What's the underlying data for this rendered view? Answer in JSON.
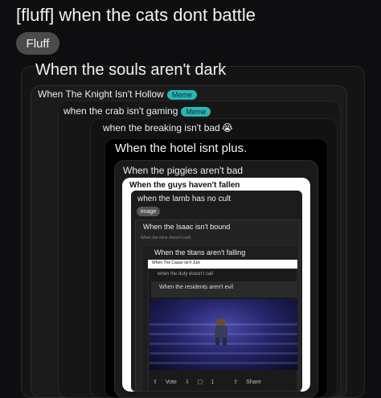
{
  "post": {
    "title": "[fluff] when the cats dont battle",
    "flair": "Fluff"
  },
  "nested": [
    {
      "text": "When the souls aren't dark"
    },
    {
      "text": "When The Knight Isn't Hollow",
      "badge": "Meme"
    },
    {
      "text": "when the crab isn't gaming",
      "badge": "Meme"
    },
    {
      "text": "when the breaking isn't bad",
      "emoji": "😭"
    },
    {
      "text": "When the hotel isnt plus."
    },
    {
      "text": "When the piggies aren't bad"
    },
    {
      "text": "When the guys haven't fallen"
    },
    {
      "text": "when the lamb has no cult",
      "badge": "Image"
    },
    {
      "text": "When the Isaac isn't bound"
    },
    {
      "text": "When the mine doesn't craft"
    },
    {
      "text": "When the titans aren't falling"
    },
    {
      "text": "When The Cause Isn't Just"
    },
    {
      "text": "when the duty doesn't call"
    },
    {
      "text": "When the residents aren't evil"
    }
  ],
  "actions": {
    "vote": "Vote",
    "comments": "1",
    "share": "Share"
  },
  "colors": {
    "background": "#0e0e10",
    "meme_badge": "#2bb5b5"
  }
}
